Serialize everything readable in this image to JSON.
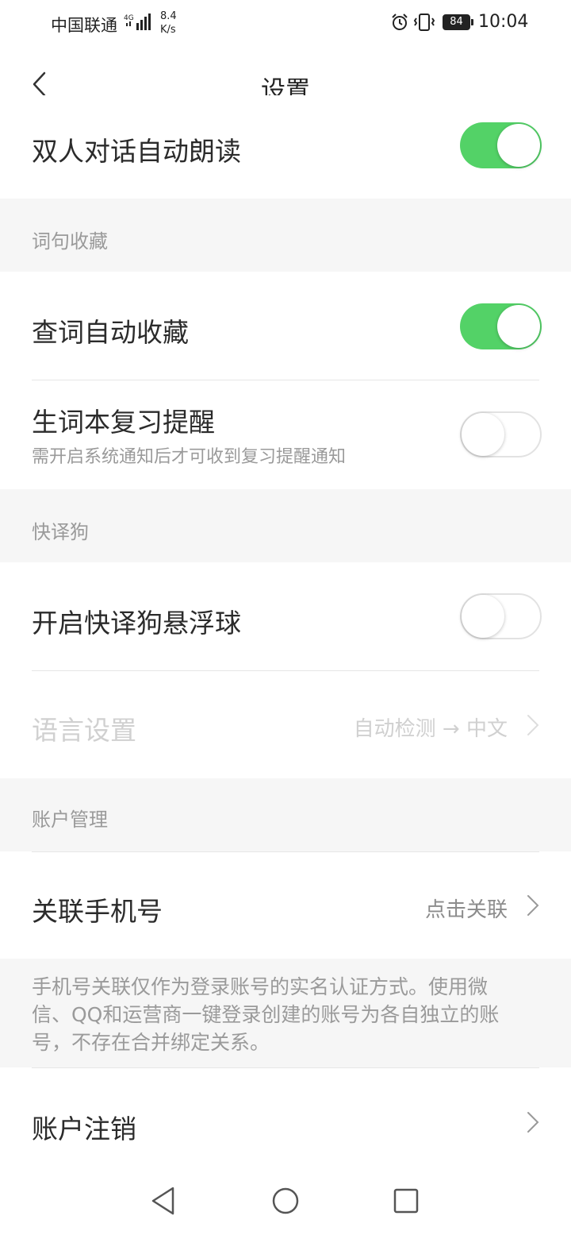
{
  "status_bar": {
    "carrier": "中国联通",
    "network": "4G",
    "speed_value": "8.4",
    "speed_unit": "K/s",
    "battery": "84",
    "time": "10:04",
    "icons": [
      "signal-icon",
      "alarm-icon",
      "vibrate-icon",
      "battery-icon"
    ]
  },
  "header": {
    "title": "设置",
    "back_icon": "chevron-left-icon"
  },
  "rows": {
    "dialog_autoread": {
      "label": "双人对话自动朗读",
      "toggle": true
    },
    "lookup_autosave": {
      "label": "查词自动收藏",
      "toggle": true
    },
    "review_reminder": {
      "label": "生词本复习提醒",
      "sub": "需开启系统通知后才可收到复习提醒通知",
      "toggle": false
    },
    "float_ball": {
      "label": "开启快译狗悬浮球",
      "toggle": false
    },
    "language": {
      "label": "语言设置",
      "value": "自动检测 → 中文",
      "enabled": false
    },
    "bind_phone": {
      "label": "关联手机号",
      "value": "点击关联"
    },
    "cancel_account": {
      "label": "账户注销"
    }
  },
  "sections": {
    "favorites": "词句收藏",
    "translator": "快译狗",
    "account": "账户管理"
  },
  "phone_note": "手机号关联仅作为登录账号的实名认证方式。使用微信、QQ和运营商一键登录创建的账号为各自独立的账号，不存在合并绑定关系。",
  "colors": {
    "toggle_on": "#53d267",
    "section_bg": "#f6f6f6",
    "muted_text": "#9a9a9a"
  },
  "system_nav": [
    "back-triangle-icon",
    "home-circle-icon",
    "recents-square-icon"
  ]
}
